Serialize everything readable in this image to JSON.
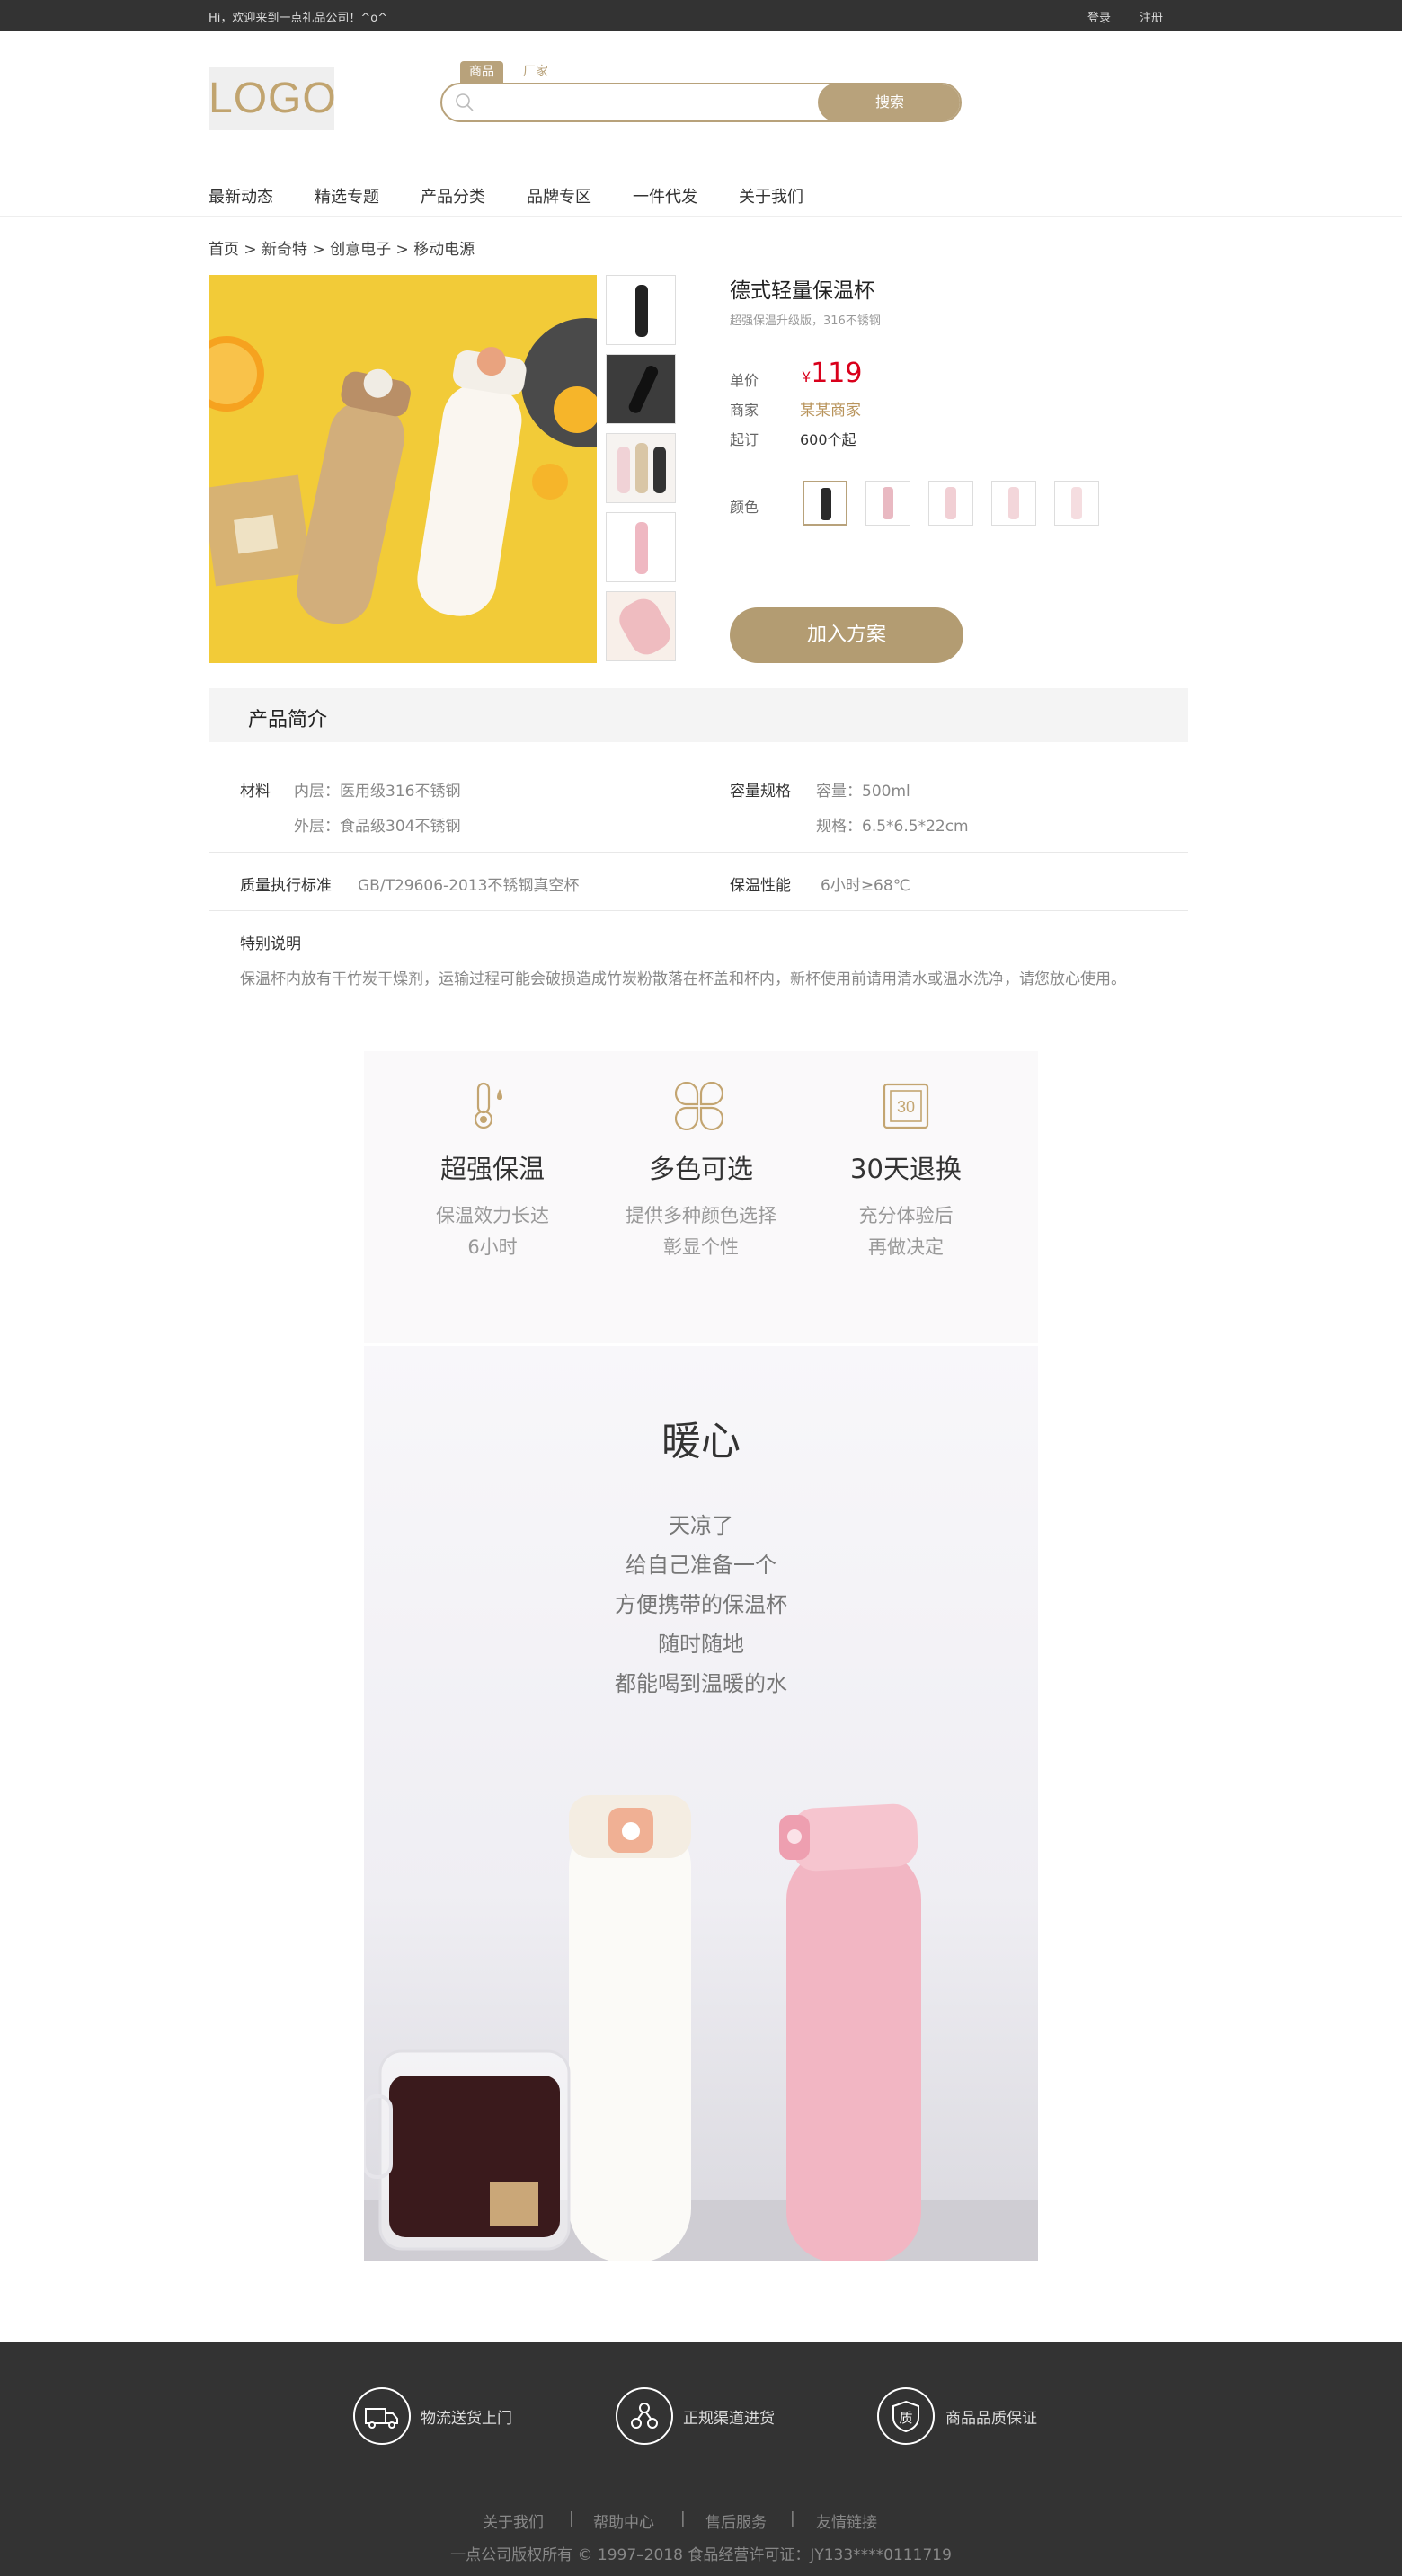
{
  "topbar": {
    "welcome": "Hi，欢迎来到一点礼品公司！^o^",
    "login": "登录",
    "register": "注册"
  },
  "header": {
    "logo": "LOGO"
  },
  "search": {
    "tabs": [
      "商品",
      "厂家"
    ],
    "placeholder": "",
    "button": "搜索"
  },
  "nav": [
    "最新动态",
    "精选专题",
    "产品分类",
    "品牌专区",
    "一件代发",
    "关于我们"
  ],
  "breadcrumb": "首页 > 新奇特 > 创意电子 > 移动电源",
  "product": {
    "title": "德式轻量保温杯",
    "subtitle": "超强保温升级版，316不锈钢",
    "price_label": "单价",
    "currency": "¥",
    "price": "119",
    "seller_label": "商家",
    "seller": "某某商家",
    "moq_label": "起订",
    "moq": "600个起",
    "color_label": "颜色",
    "swatch_colors": [
      "#2a2a2a",
      "#e9b9c2",
      "#f1cfd4",
      "#f3d6da",
      "#f5dde0"
    ],
    "add_button": "加入方案"
  },
  "intro": {
    "heading": "产品简介",
    "material_key": "材料",
    "material_inner": "内层：医用级316不锈钢",
    "material_outer": "外层：食品级304不锈钢",
    "capacity_key": "容量规格",
    "capacity": "容量：500ml",
    "size": "规格：6.5*6.5*22cm",
    "standard_key": "质量执行标准",
    "standard": "GB/T29606-2013不锈钢真空杯",
    "keep_key": "保温性能",
    "keep": "6小时≥68℃",
    "note_key": "特别说明",
    "note": "保温杯内放有干竹炭干燥剂，运输过程可能会破损造成竹炭粉散落在杯盖和杯内，新杯使用前请用清水或温水洗净，请您放心使用。"
  },
  "features": [
    {
      "icon": "thermometer-icon",
      "title": "超强保温",
      "desc1": "保温效力长达",
      "desc2": "6小时"
    },
    {
      "icon": "clover-icon",
      "title": "多色可选",
      "desc1": "提供多种颜色选择",
      "desc2": "彰显个性"
    },
    {
      "icon": "calendar-30-icon",
      "title": "30天退换",
      "desc1": "充分体验后",
      "desc2": "再做决定"
    }
  ],
  "calendar_number": "30",
  "warm": {
    "title": "暖心",
    "lines": [
      "天凉了",
      "给自己准备一个",
      "方便携带的保温杯",
      "随时随地",
      "都能喝到温暖的水"
    ]
  },
  "footer": {
    "services": [
      "物流送货上门",
      "正规渠道进货",
      "商品品质保证"
    ],
    "quality_glyph": "质",
    "links": [
      "关于我们",
      "帮助中心",
      "售后服务",
      "友情链接"
    ],
    "copyright": "一点公司版权所有 © 1997–2018   食品经营许可证：JY133****0111719"
  }
}
